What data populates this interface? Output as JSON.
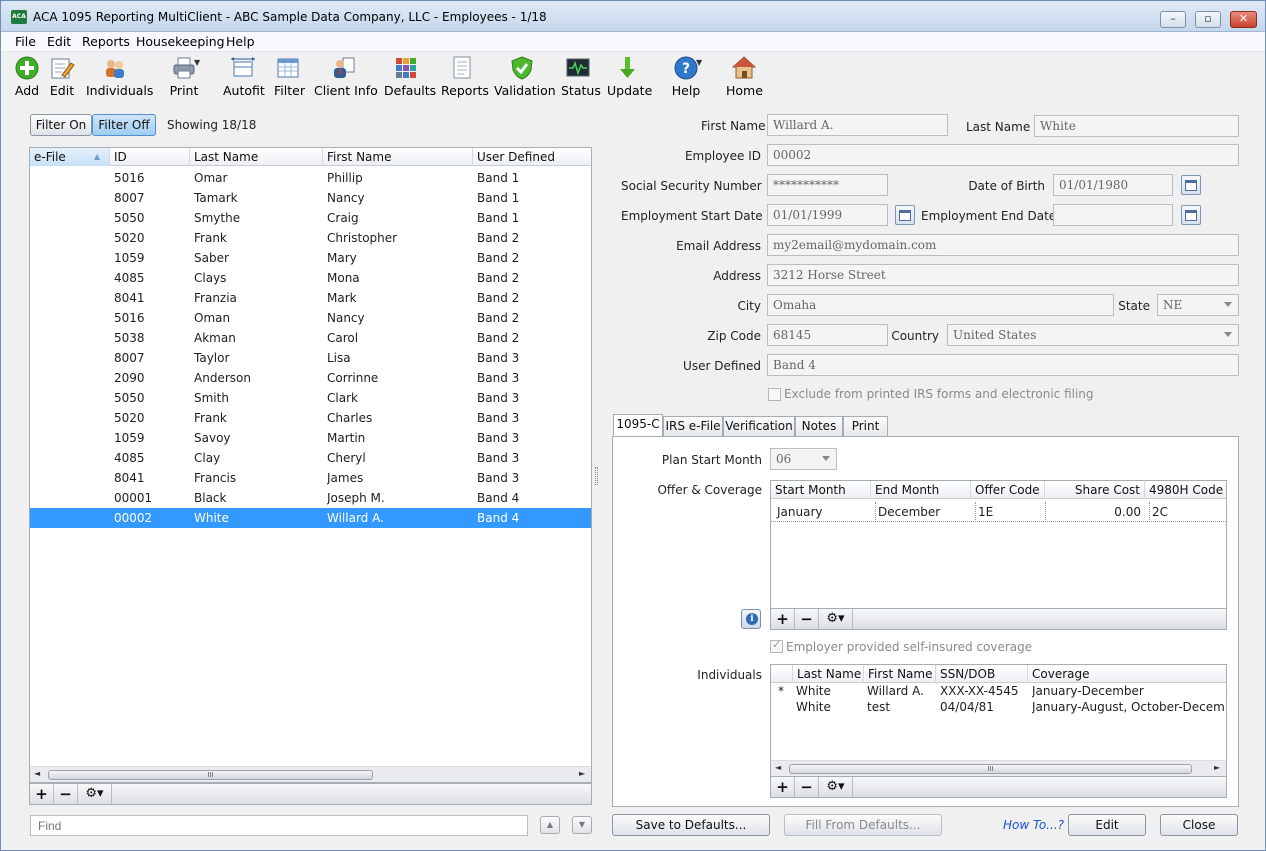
{
  "window": {
    "title": "ACA 1095 Reporting MultiClient - ABC Sample Data Company, LLC - Employees - 1/18",
    "app_icon_text": "ACA"
  },
  "menu": [
    "File",
    "Edit",
    "Reports",
    "Housekeeping",
    "Help"
  ],
  "toolbar": [
    {
      "label": "Add",
      "icon": "add-icon"
    },
    {
      "label": "Edit",
      "icon": "edit-icon"
    },
    {
      "label": "Individuals",
      "icon": "individuals-icon"
    },
    {
      "label": "Print",
      "icon": "print-icon"
    },
    {
      "label": "Autofit",
      "icon": "autofit-icon"
    },
    {
      "label": "Filter",
      "icon": "filter-icon"
    },
    {
      "label": "Client Info",
      "icon": "client-info-icon"
    },
    {
      "label": "Defaults",
      "icon": "defaults-icon"
    },
    {
      "label": "Reports",
      "icon": "reports-icon"
    },
    {
      "label": "Validation",
      "icon": "validation-icon"
    },
    {
      "label": "Status",
      "icon": "status-icon"
    },
    {
      "label": "Update",
      "icon": "update-icon"
    },
    {
      "label": "Help",
      "icon": "help-icon"
    },
    {
      "label": "Home",
      "icon": "home-icon"
    }
  ],
  "filter": {
    "on_label": "Filter On",
    "off_label": "Filter Off",
    "showing": "Showing 18/18"
  },
  "employee_list": {
    "columns": [
      "e-File",
      "ID",
      "Last Name",
      "First Name",
      "User Defined"
    ],
    "rows": [
      {
        "efile": "",
        "id": "5016",
        "last": "Omar",
        "first": "Phillip",
        "user": "Band 1"
      },
      {
        "efile": "",
        "id": "8007",
        "last": "Tamark",
        "first": "Nancy",
        "user": "Band 1"
      },
      {
        "efile": "",
        "id": "5050",
        "last": "Smythe",
        "first": "Craig",
        "user": "Band 1"
      },
      {
        "efile": "",
        "id": "5020",
        "last": "Frank",
        "first": "Christopher",
        "user": "Band 2"
      },
      {
        "efile": "",
        "id": "1059",
        "last": "Saber",
        "first": "Mary",
        "user": "Band 2"
      },
      {
        "efile": "",
        "id": "4085",
        "last": "Clays",
        "first": "Mona",
        "user": "Band 2"
      },
      {
        "efile": "",
        "id": "8041",
        "last": "Franzia",
        "first": "Mark",
        "user": "Band 2"
      },
      {
        "efile": "",
        "id": "5016",
        "last": "Oman",
        "first": "Nancy",
        "user": "Band 2"
      },
      {
        "efile": "",
        "id": "5038",
        "last": "Akman",
        "first": "Carol",
        "user": "Band 2"
      },
      {
        "efile": "",
        "id": "8007",
        "last": "Taylor",
        "first": "Lisa",
        "user": "Band 3"
      },
      {
        "efile": "",
        "id": "2090",
        "last": "Anderson",
        "first": "Corrinne",
        "user": "Band 3"
      },
      {
        "efile": "",
        "id": "5050",
        "last": "Smith",
        "first": "Clark",
        "user": "Band 3"
      },
      {
        "efile": "",
        "id": "5020",
        "last": "Frank",
        "first": "Charles",
        "user": "Band 3"
      },
      {
        "efile": "",
        "id": "1059",
        "last": "Savoy",
        "first": "Martin",
        "user": "Band 3"
      },
      {
        "efile": "",
        "id": "4085",
        "last": "Clay",
        "first": "Cheryl",
        "user": "Band 3"
      },
      {
        "efile": "",
        "id": "8041",
        "last": "Francis",
        "first": "James",
        "user": "Band 3"
      },
      {
        "efile": "",
        "id": "00001",
        "last": "Black",
        "first": "Joseph M.",
        "user": "Band 4"
      },
      {
        "efile": "",
        "id": "00002",
        "last": "White",
        "first": "Willard A.",
        "user": "Band 4",
        "selected": true
      }
    ],
    "scroll_grip": "III"
  },
  "find": {
    "placeholder": "Find"
  },
  "form": {
    "first_name_label": "First Name",
    "first_name": "Willard A.",
    "last_name_label": "Last Name",
    "last_name": "White",
    "employee_id_label": "Employee ID",
    "employee_id": "00002",
    "ssn_label": "Social Security Number",
    "ssn": "***********",
    "dob_label": "Date of Birth",
    "dob": "01/01/1980",
    "start_label": "Employment Start Date",
    "start": "01/01/1999",
    "end_label": "Employment End Date",
    "end": "",
    "email_label": "Email Address",
    "email": "my2email@mydomain.com",
    "address_label": "Address",
    "address": "3212 Horse Street",
    "city_label": "City",
    "city": "Omaha",
    "state_label": "State",
    "state": "NE",
    "zip_label": "Zip Code",
    "zip": "68145",
    "country_label": "Country",
    "country": "United States",
    "user_defined_label": "User Defined",
    "user_defined": "Band 4",
    "exclude_label": "Exclude from printed IRS forms and electronic filing"
  },
  "tabs": [
    "1095-C",
    "IRS e-File",
    "Verification",
    "Notes",
    "Print"
  ],
  "tab_1095c": {
    "plan_start_label": "Plan Start Month",
    "plan_start": "06",
    "offer_label": "Offer & Coverage",
    "offer_columns": [
      "Start Month",
      "End Month",
      "Offer Code",
      "Share Cost",
      "4980H Code"
    ],
    "offer_rows": [
      {
        "start": "January",
        "end": "December",
        "code": "1E",
        "cost": "0.00",
        "h": "2C"
      }
    ],
    "self_insured_label": "Employer provided self-insured coverage",
    "individuals_label": "Individuals",
    "ind_columns": [
      "",
      "Last Name",
      "First Name",
      "SSN/DOB",
      "Coverage"
    ],
    "ind_rows": [
      {
        "mark": "*",
        "last": "White",
        "first": "Willard A.",
        "ssn": "XXX-XX-4545",
        "coverage": "January-December"
      },
      {
        "mark": "",
        "last": "White",
        "first": "test",
        "ssn": "04/04/81",
        "coverage": "January-August, October-December"
      }
    ]
  },
  "footer": {
    "save_defaults": "Save to Defaults...",
    "fill_defaults": "Fill From Defaults...",
    "how_to": "How To...?",
    "edit": "Edit",
    "close": "Close"
  },
  "colors": {
    "selection": "#3399ff",
    "link": "#1f4fd6",
    "title_bar": "#c6d7ec"
  }
}
